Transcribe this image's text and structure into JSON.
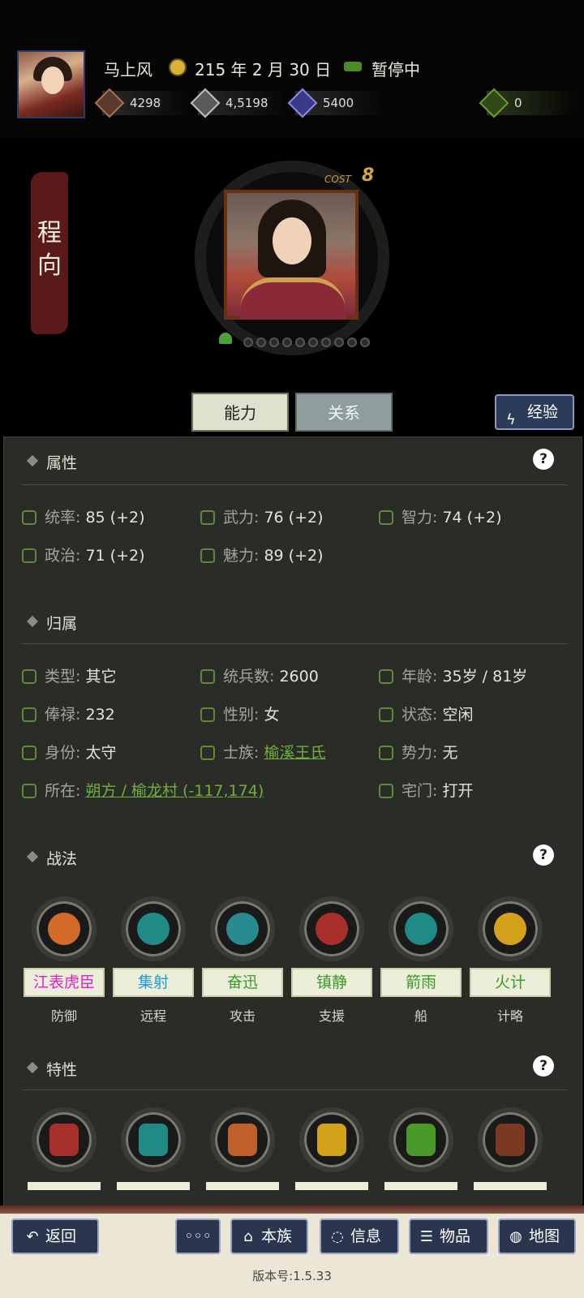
{
  "header": {
    "player_name": "马上风",
    "date": "215 年 2 月 30 日",
    "status": "暂停中",
    "resources": [
      "4298",
      "4,5198",
      "5400",
      "0"
    ]
  },
  "character": {
    "name_vertical": "程\n向",
    "cost_label": "COST",
    "cost_value": "8"
  },
  "tabs": {
    "ability": "能力",
    "relation": "关系",
    "experience": "经验"
  },
  "sections": {
    "attributes": "属性",
    "affiliation": "归属",
    "tactics": "战法",
    "traits": "特性"
  },
  "attributes": [
    {
      "label": "统率",
      "value": "85 (+2)"
    },
    {
      "label": "武力",
      "value": "76 (+2)"
    },
    {
      "label": "智力",
      "value": "74 (+2)"
    },
    {
      "label": "政治",
      "value": "71 (+2)"
    },
    {
      "label": "魅力",
      "value": "89 (+2)"
    }
  ],
  "affiliation": [
    {
      "label": "类型",
      "value": "其它"
    },
    {
      "label": "统兵数",
      "value": "2600"
    },
    {
      "label": "年龄",
      "value": "35岁 / 81岁"
    },
    {
      "label": "俸禄",
      "value": "232"
    },
    {
      "label": "性别",
      "value": "女"
    },
    {
      "label": "状态",
      "value": "空闲"
    },
    {
      "label": "身份",
      "value": "太守"
    },
    {
      "label": "士族",
      "value": "榆溪王氏"
    },
    {
      "label": "势力",
      "value": "无"
    },
    {
      "label": "所在",
      "value": "朔方 / 榆龙村 (-117,174)"
    },
    {
      "label": "宅门",
      "value": "打开"
    }
  ],
  "tactics": [
    {
      "name": "江表虎臣",
      "type": "防御",
      "color": "#e020c8"
    },
    {
      "name": "集射",
      "type": "远程",
      "color": "#1f9ad6"
    },
    {
      "name": "奋迅",
      "type": "攻击",
      "color": "#3a9a2a"
    },
    {
      "name": "镇静",
      "type": "支援",
      "color": "#3a9a2a"
    },
    {
      "name": "箭雨",
      "type": "船",
      "color": "#3a9a2a"
    },
    {
      "name": "火计",
      "type": "计略",
      "color": "#3a9a2a"
    }
  ],
  "bottom": {
    "back": "返回",
    "more": "◦◦◦",
    "clan": "本族",
    "info": "信息",
    "items": "物品",
    "map": "地图",
    "version": "版本号:1.5.33"
  }
}
